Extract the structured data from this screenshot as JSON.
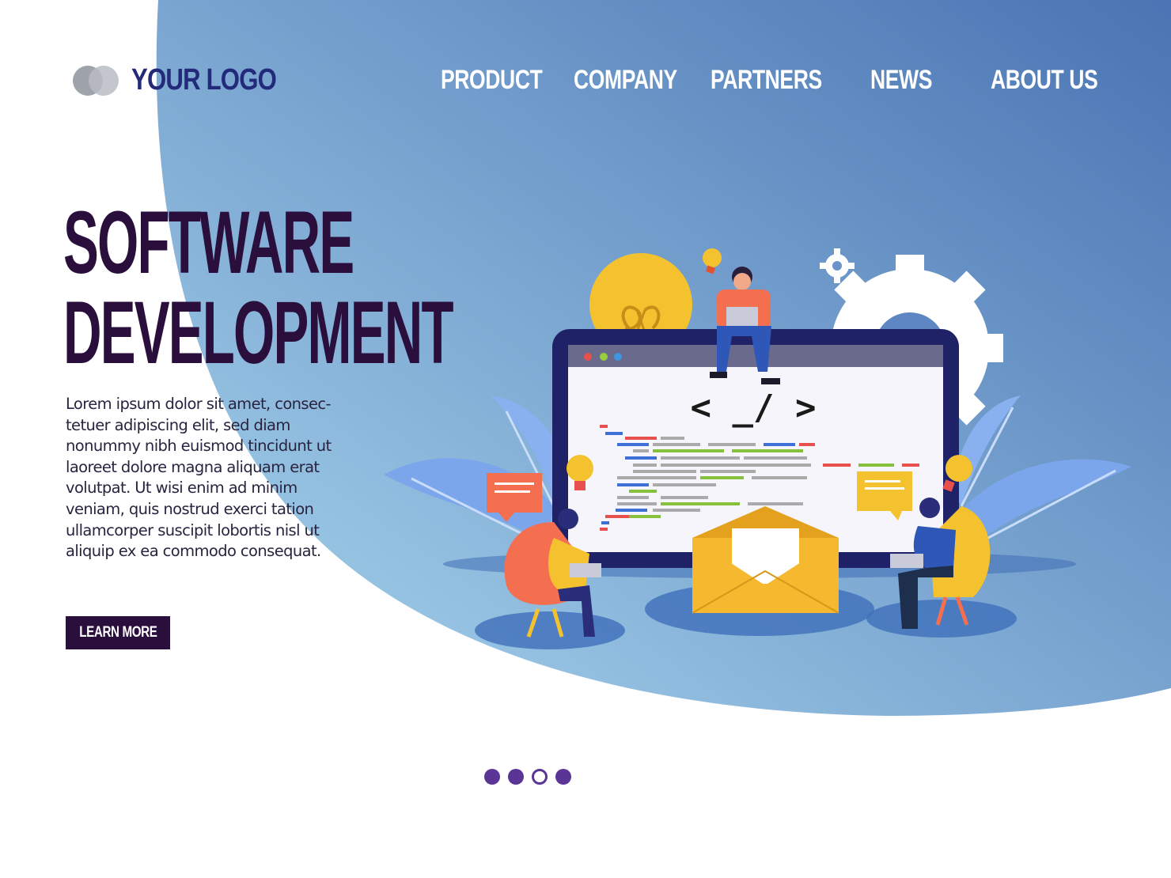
{
  "colors": {
    "blob_light": "#8fc3e3",
    "blob_dark": "#4d79b5",
    "title": "#2a0f3d",
    "logo_text": "#232a7a",
    "nav_text": "#ffffff",
    "button_bg": "#2a0f3d",
    "dot": "#5b3596",
    "monitor_frame": "#1f2266",
    "screen": "#f6f5fb",
    "bulb": "#f5c22f",
    "envelope": "#f5b82e",
    "gear": "#ffffff",
    "leaf": "#7ca6ec"
  },
  "header": {
    "logo_text": "YOUR LOGO",
    "nav": [
      {
        "label": "PRODUCT"
      },
      {
        "label": "COMPANY"
      },
      {
        "label": "PARTNERS"
      },
      {
        "label": "NEWS"
      },
      {
        "label": "ABOUT US"
      }
    ]
  },
  "hero": {
    "title_lines": [
      "SOFTWARE",
      "DEVELOPMENT"
    ],
    "body_lines": [
      "Lorem ipsum dolor sit amet, consec-",
      "tetuer adipiscing elit, sed diam",
      "nonummy nibh euismod tincidunt ut",
      "laoreet dolore magna aliquam erat",
      "volutpat. Ut wisi enim ad minim",
      "veniam, quis nostrud exerci tation",
      "ullamcorper suscipit lobortis nisl ut",
      "aliquip ex ea commodo consequat."
    ],
    "cta_label": "LEARN MORE"
  },
  "illustration": {
    "code_symbol": "< _/ >"
  },
  "pagination": {
    "total": 4,
    "active_index": 2
  }
}
